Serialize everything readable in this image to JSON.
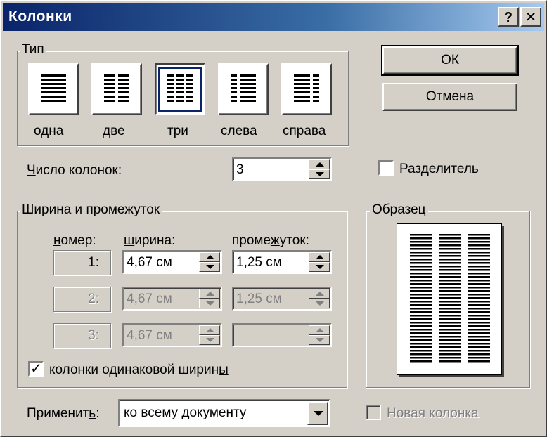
{
  "window": {
    "title": "Колонки",
    "help_button": "?",
    "close_button": "✕"
  },
  "type_group": {
    "label": "Тип",
    "presets": [
      {
        "id": "one",
        "label": "одна",
        "underline": "о",
        "rest": "дна",
        "selected": false
      },
      {
        "id": "two",
        "label": "две",
        "underline": "д",
        "rest": "ве",
        "selected": false
      },
      {
        "id": "three",
        "label": "три",
        "underline": "т",
        "rest": "ри",
        "selected": true
      },
      {
        "id": "left",
        "label": "слева",
        "underline": "л",
        "before": "с",
        "rest": "ева",
        "selected": false
      },
      {
        "id": "right",
        "label": "справа",
        "underline": "п",
        "before": "с",
        "rest": "рава",
        "selected": false
      }
    ]
  },
  "buttons": {
    "ok": "ОК",
    "cancel": "Отмена"
  },
  "num_columns": {
    "label_underline": "Ч",
    "label_rest": "исло колонок:",
    "value": "3"
  },
  "separator": {
    "label_underline": "Р",
    "label_rest": "азделитель",
    "checked": false
  },
  "width_group": {
    "label": "Ширина и промежуток",
    "headers": {
      "number_u": "н",
      "number_rest": "омер:",
      "width_u": "ш",
      "width_rest": "ирина:",
      "spacing_before": "проме",
      "spacing_u": "ж",
      "spacing_rest": "уток:"
    },
    "rows": [
      {
        "number": "1:",
        "width": "4,67 см",
        "spacing": "1,25 см",
        "enabled": true
      },
      {
        "number": "2:",
        "width": "4,67 см",
        "spacing": "1,25 см",
        "enabled": false
      },
      {
        "number": "3:",
        "width": "4,67 см",
        "spacing": "",
        "enabled": false
      }
    ],
    "equal_width": {
      "label_main": "колонки одинаковой ширин",
      "label_underline": "ы",
      "checked": true
    }
  },
  "preview": {
    "label": "Образец",
    "columns": 3
  },
  "apply": {
    "label_before": "Применит",
    "label_underline": "ь",
    "label_after": ":",
    "value": "ко всему документу"
  },
  "new_column": {
    "label": "Новая колонка",
    "checked": false,
    "enabled": false
  },
  "colors": {
    "face": "#d4d0c8",
    "titlebar_start": "#0a246a",
    "titlebar_end": "#a6caf0",
    "disabled_text": "#808080"
  }
}
